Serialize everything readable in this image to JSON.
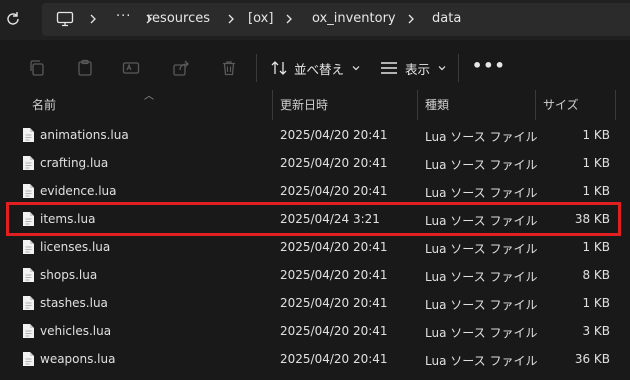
{
  "address_bar": {
    "breadcrumbs": [
      "resources",
      "[ox]",
      "ox_inventory",
      "data"
    ],
    "overflow": "···"
  },
  "toolbar": {
    "sort_label": "並べ替え",
    "view_label": "表示",
    "more_label": "•••"
  },
  "columns": {
    "name": "名前",
    "modified": "更新日時",
    "type": "種類",
    "size": "サイズ"
  },
  "files": [
    {
      "name": "animations.lua",
      "modified": "2025/04/20 20:41",
      "type": "Lua ソース ファイル",
      "size": "1 KB"
    },
    {
      "name": "crafting.lua",
      "modified": "2025/04/20 20:41",
      "type": "Lua ソース ファイル",
      "size": "1 KB"
    },
    {
      "name": "evidence.lua",
      "modified": "2025/04/20 20:41",
      "type": "Lua ソース ファイル",
      "size": "1 KB"
    },
    {
      "name": "items.lua",
      "modified": "2025/04/24 3:21",
      "type": "Lua ソース ファイル",
      "size": "38 KB"
    },
    {
      "name": "licenses.lua",
      "modified": "2025/04/20 20:41",
      "type": "Lua ソース ファイル",
      "size": "1 KB"
    },
    {
      "name": "shops.lua",
      "modified": "2025/04/20 20:41",
      "type": "Lua ソース ファイル",
      "size": "8 KB"
    },
    {
      "name": "stashes.lua",
      "modified": "2025/04/20 20:41",
      "type": "Lua ソース ファイル",
      "size": "1 KB"
    },
    {
      "name": "vehicles.lua",
      "modified": "2025/04/20 20:41",
      "type": "Lua ソース ファイル",
      "size": "3 KB"
    },
    {
      "name": "weapons.lua",
      "modified": "2025/04/20 20:41",
      "type": "Lua ソース ファイル",
      "size": "36 KB"
    }
  ],
  "highlighted_file": "items.lua",
  "colors": {
    "background": "#191919",
    "highlight_border": "#e02020"
  },
  "icons": [
    "refresh-icon",
    "computer-icon",
    "chevron-right-icon",
    "copy-icon",
    "paste-icon",
    "rename-icon",
    "share-icon",
    "delete-icon",
    "sort-icon",
    "view-icon",
    "lua-file-icon"
  ]
}
